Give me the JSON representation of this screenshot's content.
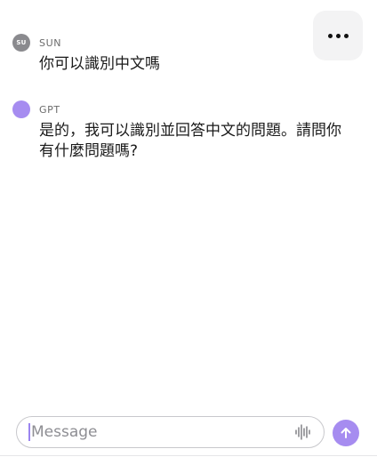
{
  "header": {
    "more_icon": "ellipsis-icon"
  },
  "messages": [
    {
      "role": "user",
      "avatar_initials": "SU",
      "sender": "SUN",
      "text": "你可以識別中文嗎",
      "avatar_color": "#8a8a8e"
    },
    {
      "role": "assistant",
      "avatar_initials": "",
      "sender": "GPT",
      "text": "是的，我可以識別並回答中文的問題。請問你有什麼問題嗎?",
      "avatar_color": "#a68cf0"
    }
  ],
  "composer": {
    "placeholder": "Message",
    "value": "",
    "voice_icon": "waveform-icon",
    "send_icon": "arrow-up-icon",
    "accent_color": "#a68cf0"
  }
}
